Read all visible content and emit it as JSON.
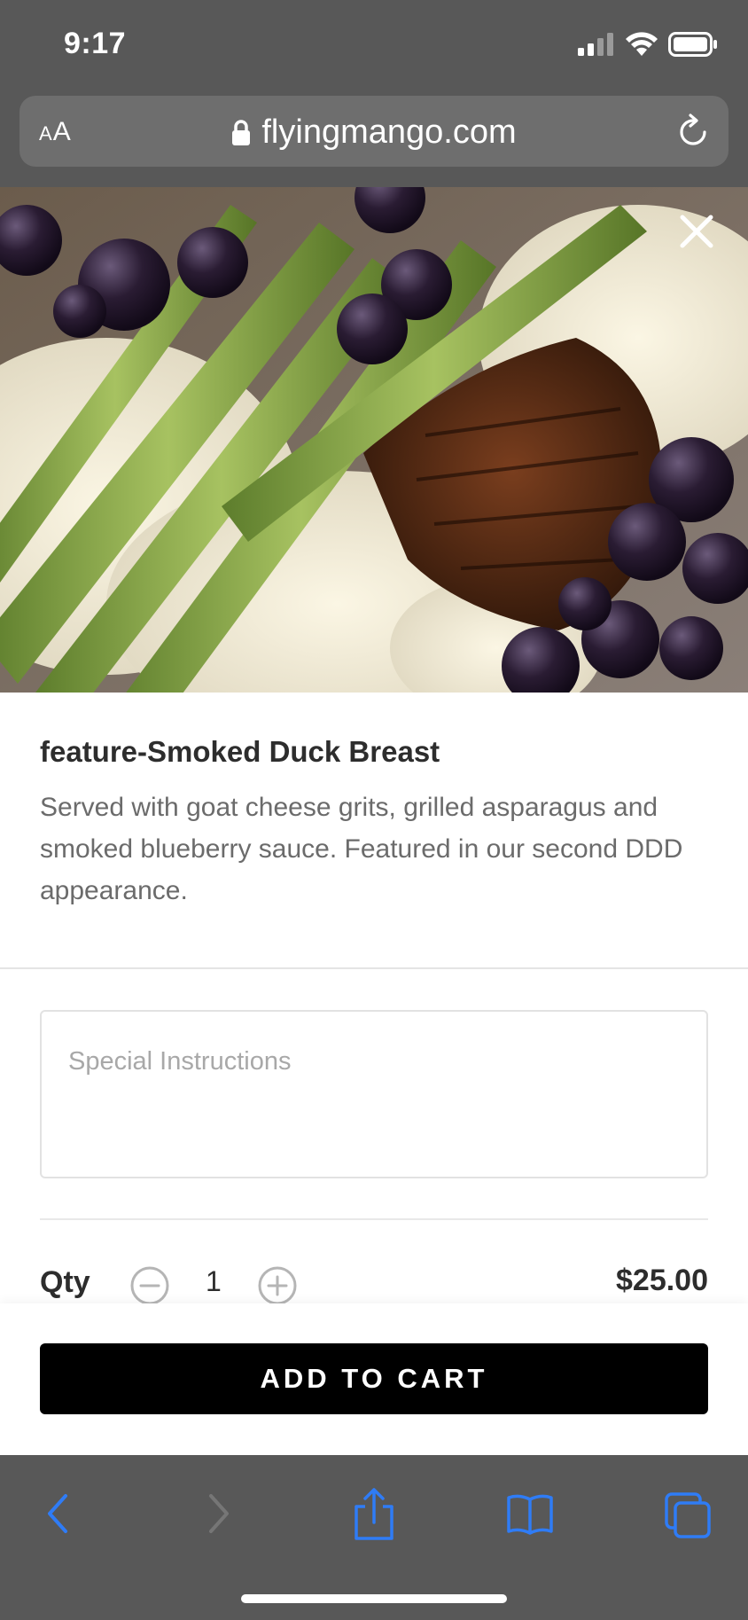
{
  "status_bar": {
    "time": "9:17"
  },
  "browser": {
    "text_size_label_small": "A",
    "text_size_label_large": "A",
    "url": "flyingmango.com"
  },
  "item": {
    "title": "feature-Smoked Duck Breast",
    "description": "Served with goat cheese grits, grilled asparagus and smoked blueberry sauce. Featured in our second DDD appearance.",
    "special_instructions_placeholder": "Special Instructions",
    "qty_label": "Qty",
    "quantity": "1",
    "price": "$25.00",
    "add_to_cart_label": "ADD TO CART"
  },
  "icons": {
    "lock": "lock-icon",
    "reload": "reload-icon",
    "close": "close-icon",
    "minus": "minus-circle-icon",
    "plus": "plus-circle-icon",
    "back": "chevron-left-icon",
    "forward": "chevron-right-icon",
    "share": "share-icon",
    "bookmarks": "book-icon",
    "tabs": "tabs-icon"
  },
  "colors": {
    "browser_chrome": "#585858",
    "toolbar_accent": "#2f7cf6",
    "button_bg": "#000000",
    "text_dark": "#2d2d2d",
    "text_muted": "#6b6b6b"
  }
}
